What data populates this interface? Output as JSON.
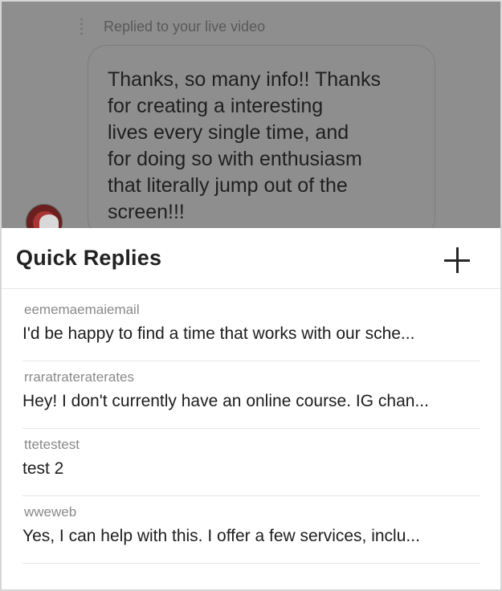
{
  "chat": {
    "reply_context": "Replied to your live video",
    "message_lines": [
      "Thanks, so many info!! Thanks",
      "for creating a interesting",
      "lives every single time, and",
      "for doing so with enthusiasm",
      "that literally jump out of the",
      "screen!!!"
    ]
  },
  "sheet": {
    "title": "Quick Replies",
    "add_icon": "plus-icon",
    "replies": [
      {
        "shortcut": "eememaemaiemail",
        "text": "I'd be happy to find a time that works with our sche..."
      },
      {
        "shortcut": "rraratrateraterates",
        "text": "Hey! I don't currently have an online course. IG chan..."
      },
      {
        "shortcut": "ttetestest",
        "text": "test 2"
      },
      {
        "shortcut": "wweweb",
        "text": "Yes, I can help with this. I offer a few services, inclu..."
      }
    ]
  },
  "colors": {
    "overlay": "#8e8e8e",
    "sheet_background": "#ffffff",
    "divider": "#e6e6e6",
    "secondary_text": "#8a8a8a"
  }
}
